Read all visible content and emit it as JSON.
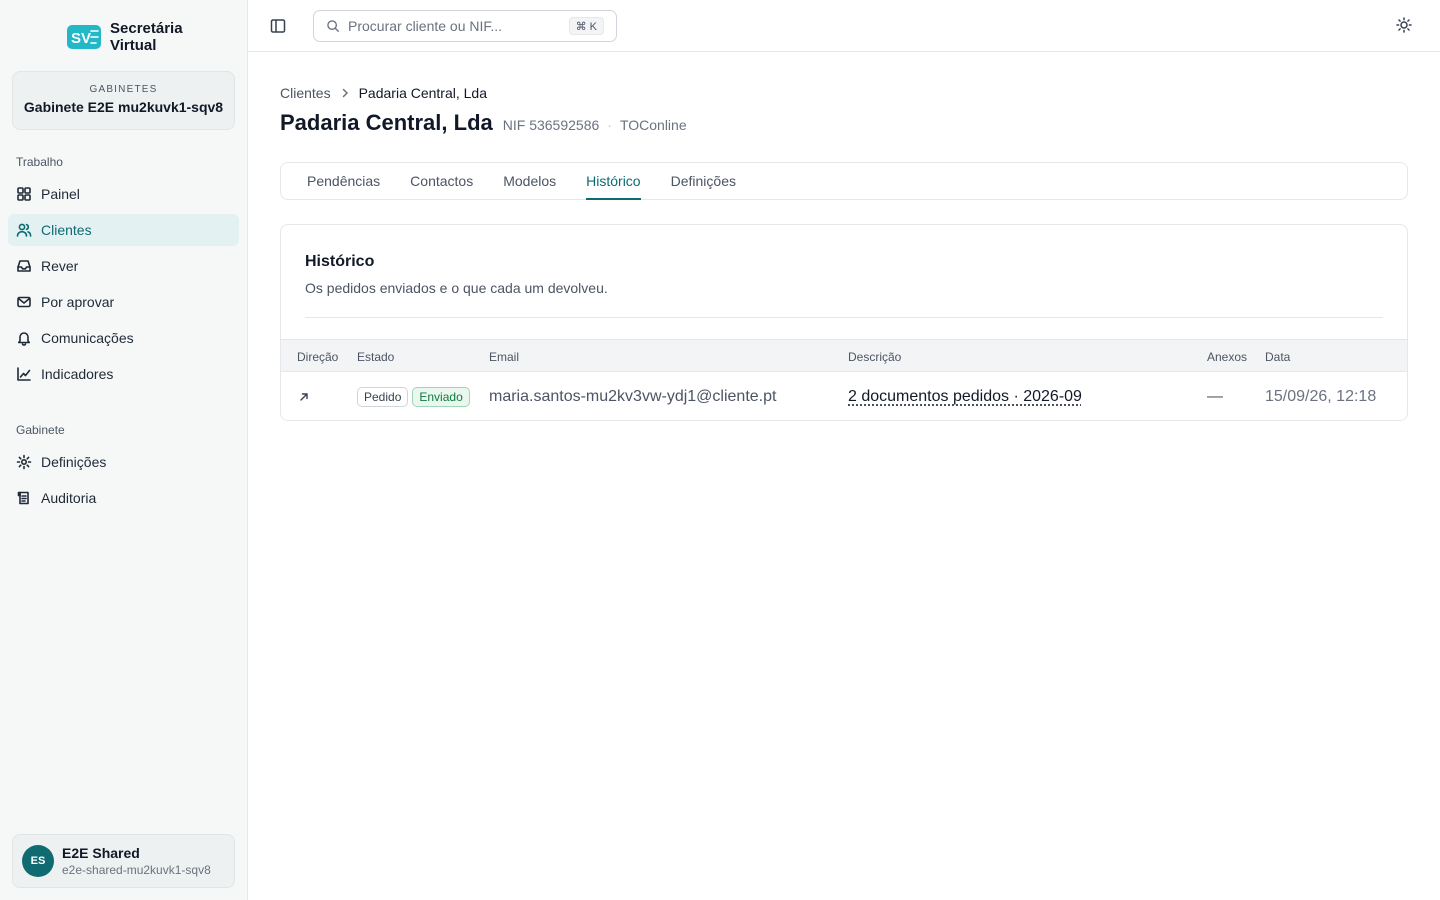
{
  "brand": {
    "line1": "Secretária",
    "line2": "Virtual"
  },
  "org": {
    "label": "GABINETES",
    "name": "Gabinete E2E mu2kuvk1-sqv8"
  },
  "sidebar": {
    "work_section": "Trabalho",
    "work_items": [
      {
        "label": "Painel",
        "icon": "grid-icon"
      },
      {
        "label": "Clientes",
        "icon": "users-icon",
        "active": true
      },
      {
        "label": "Rever",
        "icon": "inbox-icon"
      },
      {
        "label": "Por aprovar",
        "icon": "mail-icon"
      },
      {
        "label": "Comunicações",
        "icon": "bell-icon"
      },
      {
        "label": "Indicadores",
        "icon": "chart-icon"
      }
    ],
    "office_section": "Gabinete",
    "office_items": [
      {
        "label": "Definições",
        "icon": "gear-icon"
      },
      {
        "label": "Auditoria",
        "icon": "scroll-icon"
      }
    ]
  },
  "user": {
    "initials": "ES",
    "name": "E2E Shared",
    "email": "e2e-shared-mu2kuvk1-sqv8"
  },
  "search": {
    "placeholder": "Procurar cliente ou NIF...",
    "shortcut": "⌘ K"
  },
  "breadcrumb": {
    "parent": "Clientes",
    "current": "Padaria Central, Lda"
  },
  "header": {
    "title": "Padaria Central, Lda",
    "nif": "NIF 536592586",
    "separator": "·",
    "integration": "TOConline"
  },
  "tabs": [
    {
      "label": "Pendências"
    },
    {
      "label": "Contactos"
    },
    {
      "label": "Modelos"
    },
    {
      "label": "Histórico",
      "active": true
    },
    {
      "label": "Definições"
    }
  ],
  "history": {
    "title": "Histórico",
    "description": "Os pedidos enviados e o que cada um devolveu.",
    "columns": [
      "Direção",
      "Estado",
      "Email",
      "Descrição",
      "Anexos",
      "Data"
    ],
    "rows": [
      {
        "direction_icon": "arrow-up-right-icon",
        "type_badge": "Pedido",
        "status_badge": "Enviado",
        "email": "maria.santos-mu2kv3vw-ydj1@cliente.pt",
        "description": "2 documentos pedidos · 2026-09",
        "attachments": "—",
        "date": "15/09/26, 12:18"
      }
    ]
  },
  "colors": {
    "accent": "#0e6b72",
    "accent_bg": "#e3f1f2",
    "success": "#0f7a3c",
    "avatar": "#0f6b70",
    "logo": "#22b8c8"
  }
}
